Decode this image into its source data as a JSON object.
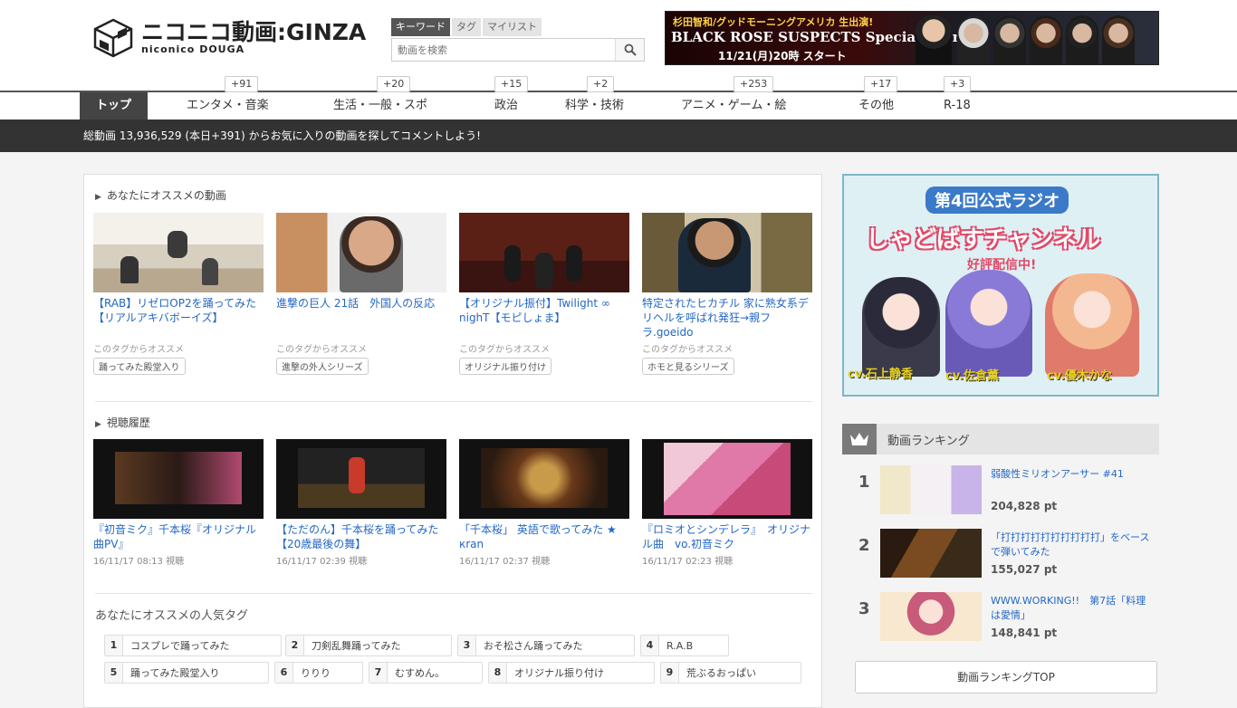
{
  "logo": {
    "main": "ニコニコ動画:GINZA",
    "sub": "niconico DOUGA"
  },
  "search": {
    "tabs": [
      "キーワード",
      "タグ",
      "マイリスト"
    ],
    "placeholder": "動画を検索"
  },
  "banner": {
    "top": "杉田智和/グッドモーニングアメリカ 生出演!",
    "main": "BLACK ROSE SUSPECTS  Special Event",
    "date": "11/21(月)20時 スタート"
  },
  "nav": {
    "items": [
      {
        "label": "トップ",
        "badge": ""
      },
      {
        "label": "エンタメ・音楽",
        "badge": "+91"
      },
      {
        "label": "生活・一般・スポ",
        "badge": "+20"
      },
      {
        "label": "政治",
        "badge": "+15"
      },
      {
        "label": "科学・技術",
        "badge": "+2"
      },
      {
        "label": "アニメ・ゲーム・絵",
        "badge": "+253"
      },
      {
        "label": "その他",
        "badge": "+17"
      },
      {
        "label": "R-18",
        "badge": "+3"
      }
    ],
    "subbar": "総動画 13,936,529 (本日+391) からお気に入りの動画を探してコメントしよう!"
  },
  "recommended": {
    "title": "あなたにオススメの動画",
    "videos": [
      {
        "title": "【RAB】リゼロOP2を踊ってみた【リアルアキバボーイズ】",
        "meta": "このタグからオススメ",
        "tag": "踊ってみた殿堂入り"
      },
      {
        "title": "進撃の巨人 21話　外国人の反応",
        "meta": "このタグからオススメ",
        "tag": "進撃の外人シリーズ"
      },
      {
        "title": "【オリジナル振付】Twilight ∞ nighT【モピしょま】",
        "meta": "このタグからオススメ",
        "tag": "オリジナル振り付け"
      },
      {
        "title": "特定されたヒカチル 家に熟女系デリヘルを呼ばれ発狂→親フラ.goeido",
        "meta": "このタグからオススメ",
        "tag": "ホモと見るシリーズ"
      }
    ]
  },
  "history": {
    "title": "視聴履歴",
    "videos": [
      {
        "title": "『初音ミク』千本桜『オリジナル曲PV』",
        "time": "16/11/17 08:13 視聴"
      },
      {
        "title": "【ただのん】千本桜を踊ってみた【20歳最後の舞】",
        "time": "16/11/17 02:39 視聴"
      },
      {
        "title": "「千本桜」 英語で歌ってみた ★ кran",
        "time": "16/11/17 02:37 視聴"
      },
      {
        "title": "『ロミオとシンデレラ』　オリジナル曲　vo.初音ミク",
        "time": "16/11/17 02:23 視聴"
      }
    ]
  },
  "popular_tags": {
    "title": "あなたにオススメの人気タグ",
    "tags": [
      {
        "num": "1",
        "label": "コスプレで踊ってみた"
      },
      {
        "num": "2",
        "label": "刀剣乱舞踊ってみた"
      },
      {
        "num": "3",
        "label": "おそ松さん踊ってみた"
      },
      {
        "num": "4",
        "label": "R.A.B"
      },
      {
        "num": "5",
        "label": "踊ってみた殿堂入り"
      },
      {
        "num": "6",
        "label": "りりり"
      },
      {
        "num": "7",
        "label": "むすめん。"
      },
      {
        "num": "8",
        "label": "オリジナル振り付け"
      },
      {
        "num": "9",
        "label": "荒ぶるおっぱい"
      }
    ]
  },
  "ad": {
    "header": "第4回公式ラジオ",
    "main": "しゃどばすチャンネル",
    "sub": "好評配信中!",
    "cv": [
      "cv.石上静香",
      "cv.佐倉薫",
      "cv.優木かな"
    ]
  },
  "ranking": {
    "title": "動画ランキング",
    "items": [
      {
        "rank": "1",
        "title": "弱酸性ミリオンアーサー #41",
        "points": "204,828 pt"
      },
      {
        "rank": "2",
        "title": "「打打打打打打打打打打」をベースで弾いてみた",
        "points": "155,027 pt"
      },
      {
        "rank": "3",
        "title": "WWW.WORKING!!　第7話「料理は愛情」",
        "points": "148,841 pt"
      }
    ],
    "button": "動画ランキングTOP"
  }
}
